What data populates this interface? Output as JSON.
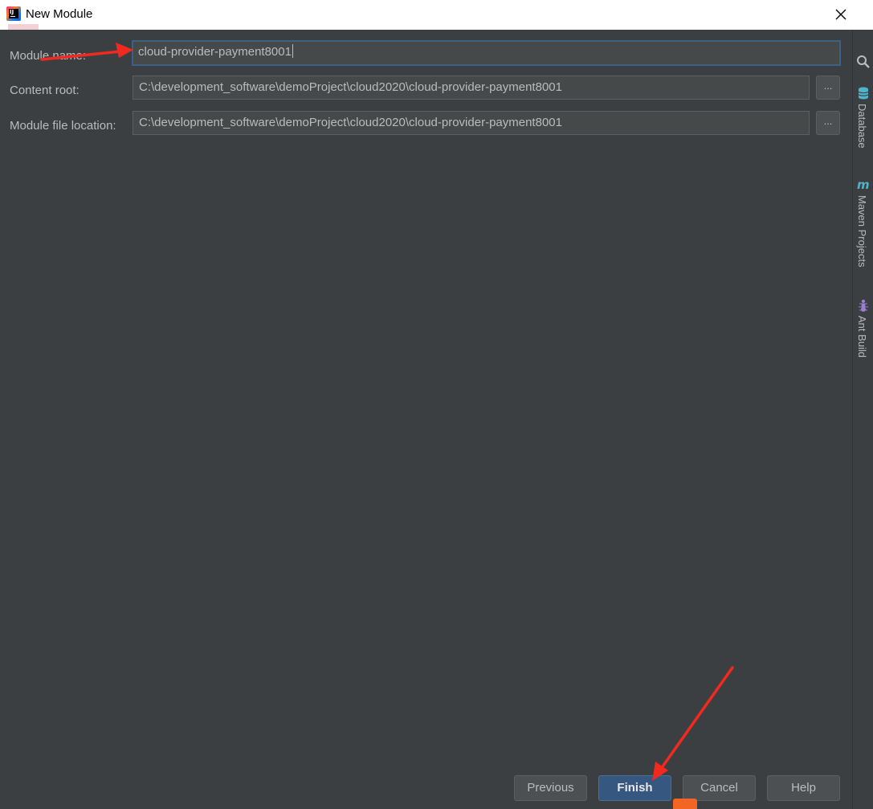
{
  "window": {
    "title": "New Module",
    "app_icon_text": "IJ"
  },
  "form": {
    "module_name": {
      "label": "Module name:",
      "value": "cloud-provider-payment8001"
    },
    "content_root": {
      "label": "Content root:",
      "value": "C:\\development_software\\demoProject\\cloud2020\\cloud-provider-payment8001",
      "browse_label": "..."
    },
    "module_file_location": {
      "label": "Module file location:",
      "value": "C:\\development_software\\demoProject\\cloud2020\\cloud-provider-payment8001",
      "browse_label": "..."
    }
  },
  "buttons": {
    "previous": "Previous",
    "finish": "Finish",
    "cancel": "Cancel",
    "help": "Help"
  },
  "side_panel": {
    "tabs": [
      {
        "label": "Database",
        "icon": "database-icon"
      },
      {
        "label": "Maven Projects",
        "icon": "maven-icon"
      },
      {
        "label": "Ant Build",
        "icon": "ant-icon"
      }
    ]
  },
  "colors": {
    "background": "#3c3f41",
    "field_background": "#45494a",
    "focus_border": "#3d6185",
    "primary_button": "#365880",
    "annotation_arrow": "#f2291e"
  }
}
